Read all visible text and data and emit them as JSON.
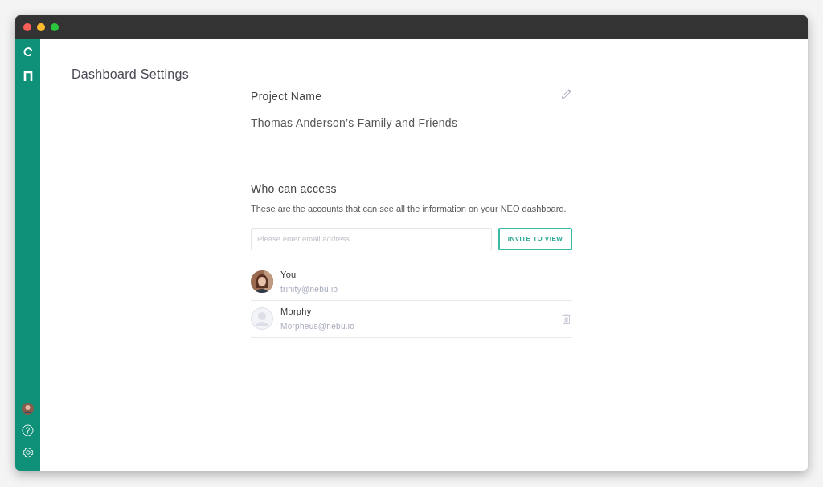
{
  "page_title": "Dashboard Settings",
  "project": {
    "label": "Project Name",
    "value": "Thomas Anderson’s Family and Friends"
  },
  "access": {
    "heading": "Who can access",
    "description": "These are the accounts that can see all the information on your NEO dashboard.",
    "email_field": {
      "placeholder": "Please enter email address"
    },
    "invite_button": "INVITE TO VIEW"
  },
  "members": [
    {
      "name": "You",
      "email": "trinity@nebu.io",
      "removable": false
    },
    {
      "name": "Morphy",
      "email": "Morpheus@nebu.io",
      "kind": "placeholder",
      "removable": true
    }
  ]
}
